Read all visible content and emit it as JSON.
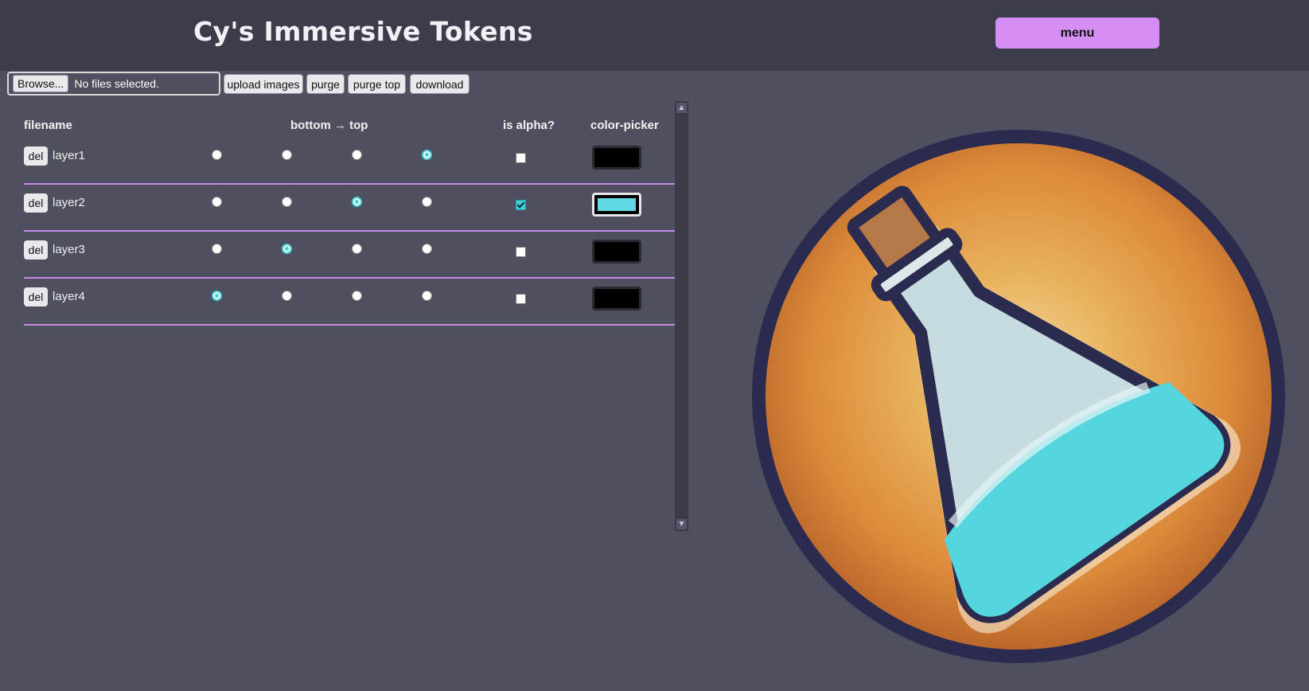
{
  "app": {
    "title": "Cy's Immersive Tokens",
    "menu_label": "menu"
  },
  "toolbar": {
    "browse_label": "Browse...",
    "file_status": "No files selected.",
    "upload_label": "upload images",
    "purge_label": "purge",
    "purge_top_label": "purge top",
    "download_label": "download"
  },
  "table": {
    "headers": {
      "filename": "filename",
      "order": "bottom → top",
      "alpha": "is alpha?",
      "color": "color-picker"
    },
    "rows": [
      {
        "delete_label": "del",
        "name": "layer1",
        "position": 4,
        "is_alpha": false,
        "color": "#000000"
      },
      {
        "delete_label": "del",
        "name": "layer2",
        "position": 3,
        "is_alpha": true,
        "color": "#5fd9e3"
      },
      {
        "delete_label": "del",
        "name": "layer3",
        "position": 2,
        "is_alpha": false,
        "color": "#000000"
      },
      {
        "delete_label": "del",
        "name": "layer4",
        "position": 1,
        "is_alpha": false,
        "color": "#000000"
      }
    ]
  },
  "colors": {
    "accent": "#d48ef4",
    "row_divider": "#c987e8",
    "radio_selected": "#45d0d6",
    "background": "#4e5060",
    "header_bg": "#3d3c4a"
  },
  "preview": {
    "icon": "potion-token-icon"
  }
}
